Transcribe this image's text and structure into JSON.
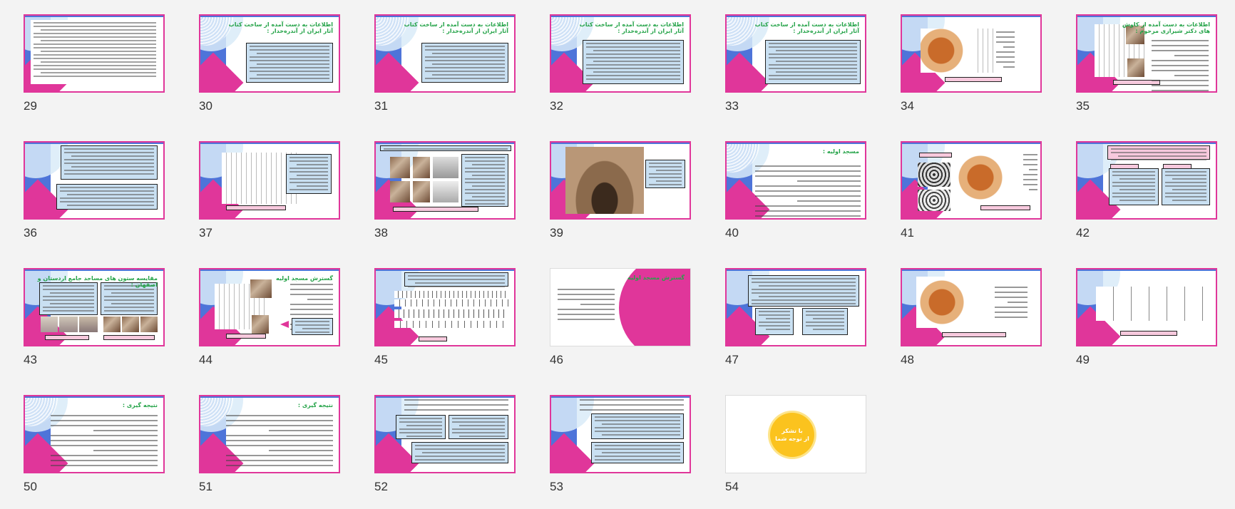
{
  "view": "slide-sorter",
  "colors": {
    "accent": "#e0369a",
    "blue": "#4e74d9",
    "title_green": "#24a348",
    "box": "#c9e0f2",
    "thanks": "#fbc31e"
  },
  "slides": [
    {
      "num": "29",
      "title": ""
    },
    {
      "num": "30",
      "title": "اطلاعات به دست آمده از ساخت کتاب\nآثار ایران از آندره‌خدار :"
    },
    {
      "num": "31",
      "title": "اطلاعات به دست آمده از ساخت کتاب\nآثار ایران از آندره‌خدار :"
    },
    {
      "num": "32",
      "title": "اطلاعات به دست آمده از ساخت کتاب\nآثار ایران از آندره‌خدار :"
    },
    {
      "num": "33",
      "title": "اطلاعات به دست آمده از ساخت کتاب\nآثار ایران از آندره‌خدار :"
    },
    {
      "num": "34",
      "title": ""
    },
    {
      "num": "35",
      "title": "اطلاعات به دست آمده از کاوش\nهای دکتر شیرازی مرحوم :"
    },
    {
      "num": "36",
      "title": ""
    },
    {
      "num": "37",
      "title": ""
    },
    {
      "num": "38",
      "title": ""
    },
    {
      "num": "39",
      "title": ""
    },
    {
      "num": "40",
      "title": "مسجد اولیه :"
    },
    {
      "num": "41",
      "title": ""
    },
    {
      "num": "42",
      "title": ""
    },
    {
      "num": "43",
      "title": "مقایسه ستون های مساجد جامع اردستان و اصفهان :"
    },
    {
      "num": "44",
      "title": "گسترش مسجد اولیه"
    },
    {
      "num": "45",
      "title": ""
    },
    {
      "num": "46",
      "title": "گسترش مسجد اولیه"
    },
    {
      "num": "47",
      "title": ""
    },
    {
      "num": "48",
      "title": ""
    },
    {
      "num": "49",
      "title": ""
    },
    {
      "num": "50",
      "title": "نتیجه گیری :"
    },
    {
      "num": "51",
      "title": "نتیجه گیری :"
    },
    {
      "num": "52",
      "title": ""
    },
    {
      "num": "53",
      "title": ""
    },
    {
      "num": "54",
      "title": "",
      "thanks": "با تشکر\nاز توجه شما"
    }
  ]
}
